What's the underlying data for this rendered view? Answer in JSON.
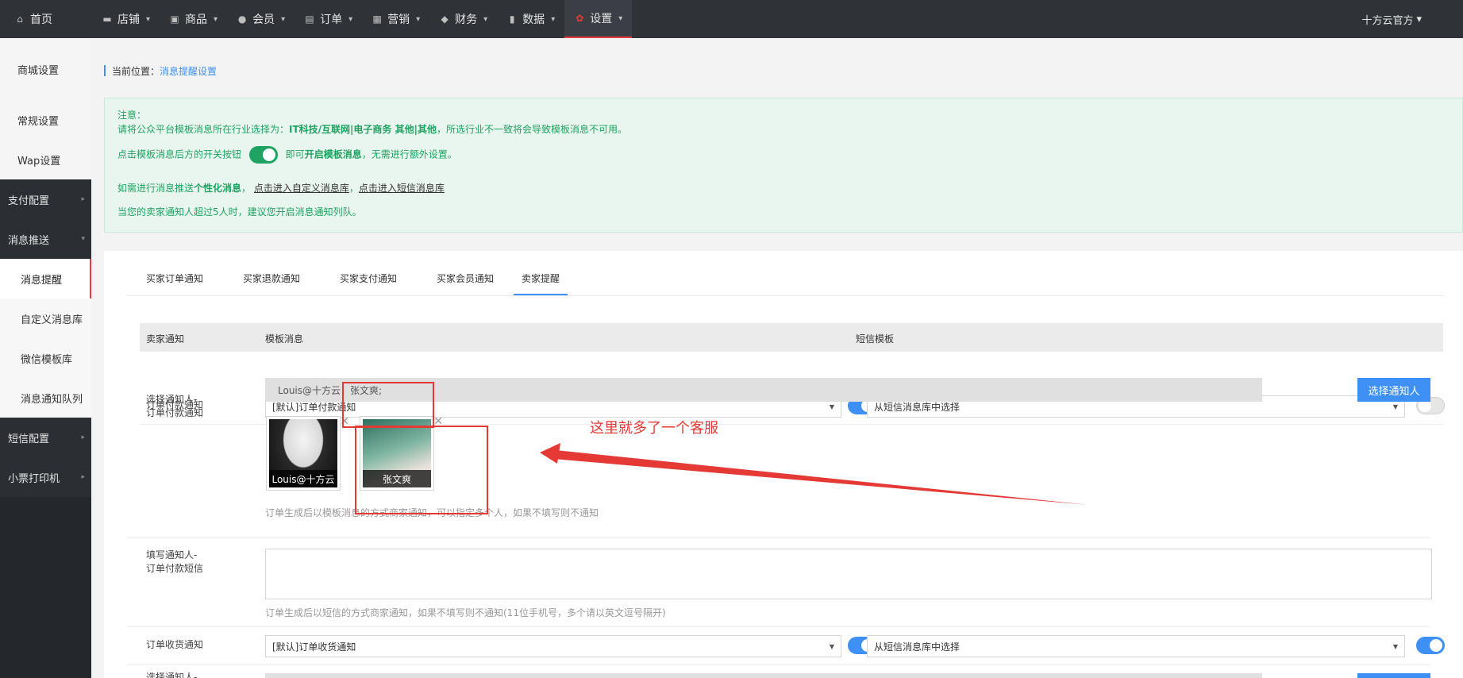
{
  "nav": {
    "home": "首页",
    "items": [
      {
        "label": "店铺"
      },
      {
        "label": "商品"
      },
      {
        "label": "会员"
      },
      {
        "label": "订单"
      },
      {
        "label": "营销"
      },
      {
        "label": "财务"
      },
      {
        "label": "数据"
      },
      {
        "label": "设置"
      }
    ],
    "account": "十方云官方"
  },
  "sidebar": {
    "top": [
      "商城设置",
      "常规设置",
      "Wap设置"
    ],
    "groups": [
      "支付配置",
      "消息推送"
    ],
    "sub": [
      "消息提醒",
      "自定义消息库",
      "微信模板库",
      "消息通知队列"
    ],
    "groups2": [
      "短信配置",
      "小票打印机"
    ]
  },
  "breadcrumb": {
    "prefix": "当前位置：",
    "current": "消息提醒设置"
  },
  "notice": {
    "title": "注意：",
    "line1_a": "请将公众平台模板消息所在行业选择为：",
    "line1_b": "IT科技/互联网|电子商务 其他|其他",
    "line1_c": "，所选行业不一致将会导致模板消息不可用。",
    "line2_a": "点击模板消息后方的开关按钮",
    "line2_b": "即可",
    "line2_c": "开启模板消息",
    "line2_d": "，无需进行额外设置。",
    "line3_a": "如需进行消息推送",
    "line3_b": "个性化消息",
    "line3_c": "，",
    "line3_link1": "点击进入自定义消息库",
    "line3_sep": "，",
    "line3_link2": "点击进入短信消息库",
    "line4": "当您的卖家通知人超过5人时，建议您开启消息通知列队。"
  },
  "tabs": [
    "买家订单通知",
    "买家退款通知",
    "买家支付通知",
    "买家会员通知",
    "卖家提醒"
  ],
  "table": {
    "headers": [
      "卖家通知",
      "模板消息",
      "短信模板"
    ],
    "row1": {
      "label": "订单付款通知",
      "template": "[默认]订单付款通知",
      "sms": "从短信消息库中选择"
    },
    "row2": {
      "label1": "选择通知人-",
      "label2": "订单付款通知",
      "picked": "Louis@十方云；张文爽;",
      "button": "选择通知人",
      "people": [
        "Louis@十方云",
        "张文爽"
      ],
      "hint": "订单生成后以模板消息的方式商家通知，可以指定多个人，如果不填写则不通知"
    },
    "row3": {
      "label1": "填写通知人-",
      "label2": "订单付款短信",
      "hint": "订单生成后以短信的方式商家通知，如果不填写则不通知(11位手机号，多个请以英文逗号隔开)"
    },
    "row4": {
      "label": "订单收货通知",
      "template": "[默认]订单收货通知",
      "sms": "从短信消息库中选择"
    },
    "row5": {
      "label1": "选择通知人-"
    }
  },
  "annotation": "这里就多了一个客服",
  "colors": {
    "accent": "#3e90f5",
    "success": "#1ea362",
    "danger": "#e53935",
    "nav": "#2f3237"
  }
}
